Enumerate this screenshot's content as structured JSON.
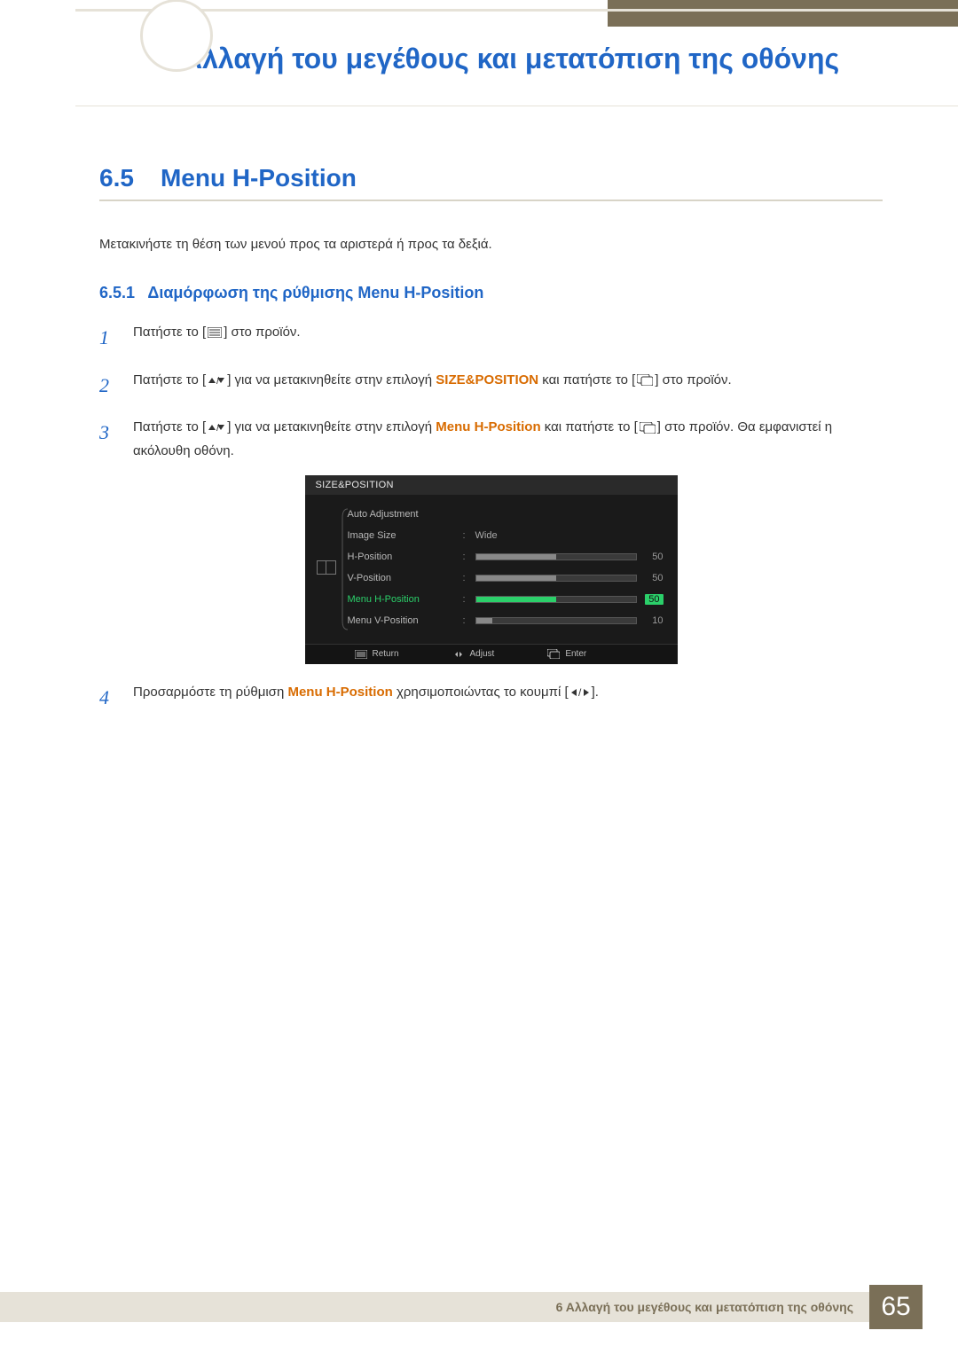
{
  "header": {
    "chapter_title": "Αλλαγή του μεγέθους και μετατόπιση της οθόνης"
  },
  "section": {
    "number": "6.5",
    "title": "Menu H-Position",
    "intro": "Μετακινήστε τη θέση των μενού προς τα αριστερά ή προς τα δεξιά."
  },
  "subsection": {
    "number": "6.5.1",
    "title": "Διαμόρφωση της ρύθμισης Menu H-Position"
  },
  "steps": [
    {
      "n": "1",
      "pre": "Πατήστε το [",
      "post": "] στο προϊόν.",
      "icon": "menu"
    },
    {
      "n": "2",
      "pre": "Πατήστε το [",
      "mid1": "] για να μετακινηθείτε στην επιλογή ",
      "highlight": "SIZE&POSITION",
      "mid2": " και πατήστε το [",
      "post": "] στο προϊόν.",
      "icon1": "updown",
      "icon2": "enter"
    },
    {
      "n": "3",
      "pre": "Πατήστε το [",
      "mid1": "] για να μετακινηθείτε στην επιλογή ",
      "highlight": "Menu H-Position",
      "mid2": " και πατήστε το [",
      "post": "] στο προϊόν. Θα εμφανιστεί η ακόλουθη οθόνη.",
      "icon1": "updown",
      "icon2": "enter"
    },
    {
      "n": "4",
      "pre": "Προσαρμόστε τη ρύθμιση ",
      "highlight": "Menu H-Position",
      "mid": " χρησιμοποιώντας το κουμπί [",
      "post": "].",
      "icon": "leftright"
    }
  ],
  "osd": {
    "title": "SIZE&POSITION",
    "rows": [
      {
        "label": "Auto Adjustment",
        "value_text": "",
        "val": "",
        "bar": false
      },
      {
        "label": "Image Size",
        "value_text": "Wide",
        "val": "",
        "bar": false
      },
      {
        "label": "H-Position",
        "value_text": "",
        "val": "50",
        "bar": true,
        "fill": 50
      },
      {
        "label": "V-Position",
        "value_text": "",
        "val": "50",
        "bar": true,
        "fill": 50
      },
      {
        "label": "Menu H-Position",
        "value_text": "",
        "val": "50",
        "bar": true,
        "fill": 50,
        "selected": true
      },
      {
        "label": "Menu V-Position",
        "value_text": "",
        "val": "10",
        "bar": true,
        "fill": 10
      }
    ],
    "footer": {
      "return": "Return",
      "adjust": "Adjust",
      "enter": "Enter"
    }
  },
  "footer": {
    "text": "6 Αλλαγή του μεγέθους και μετατόπιση της οθόνης",
    "page": "65"
  }
}
